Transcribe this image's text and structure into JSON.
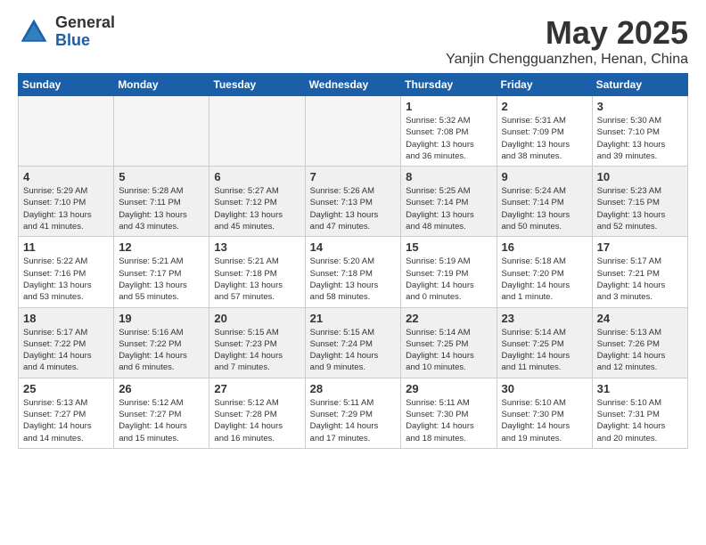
{
  "logo": {
    "general": "General",
    "blue": "Blue"
  },
  "title": {
    "month": "May 2025",
    "location": "Yanjin Chengguanzhen, Henan, China"
  },
  "weekdays": [
    "Sunday",
    "Monday",
    "Tuesday",
    "Wednesday",
    "Thursday",
    "Friday",
    "Saturday"
  ],
  "weeks": [
    [
      {
        "day": "",
        "info": ""
      },
      {
        "day": "",
        "info": ""
      },
      {
        "day": "",
        "info": ""
      },
      {
        "day": "",
        "info": ""
      },
      {
        "day": "1",
        "info": "Sunrise: 5:32 AM\nSunset: 7:08 PM\nDaylight: 13 hours\nand 36 minutes."
      },
      {
        "day": "2",
        "info": "Sunrise: 5:31 AM\nSunset: 7:09 PM\nDaylight: 13 hours\nand 38 minutes."
      },
      {
        "day": "3",
        "info": "Sunrise: 5:30 AM\nSunset: 7:10 PM\nDaylight: 13 hours\nand 39 minutes."
      }
    ],
    [
      {
        "day": "4",
        "info": "Sunrise: 5:29 AM\nSunset: 7:10 PM\nDaylight: 13 hours\nand 41 minutes."
      },
      {
        "day": "5",
        "info": "Sunrise: 5:28 AM\nSunset: 7:11 PM\nDaylight: 13 hours\nand 43 minutes."
      },
      {
        "day": "6",
        "info": "Sunrise: 5:27 AM\nSunset: 7:12 PM\nDaylight: 13 hours\nand 45 minutes."
      },
      {
        "day": "7",
        "info": "Sunrise: 5:26 AM\nSunset: 7:13 PM\nDaylight: 13 hours\nand 47 minutes."
      },
      {
        "day": "8",
        "info": "Sunrise: 5:25 AM\nSunset: 7:14 PM\nDaylight: 13 hours\nand 48 minutes."
      },
      {
        "day": "9",
        "info": "Sunrise: 5:24 AM\nSunset: 7:14 PM\nDaylight: 13 hours\nand 50 minutes."
      },
      {
        "day": "10",
        "info": "Sunrise: 5:23 AM\nSunset: 7:15 PM\nDaylight: 13 hours\nand 52 minutes."
      }
    ],
    [
      {
        "day": "11",
        "info": "Sunrise: 5:22 AM\nSunset: 7:16 PM\nDaylight: 13 hours\nand 53 minutes."
      },
      {
        "day": "12",
        "info": "Sunrise: 5:21 AM\nSunset: 7:17 PM\nDaylight: 13 hours\nand 55 minutes."
      },
      {
        "day": "13",
        "info": "Sunrise: 5:21 AM\nSunset: 7:18 PM\nDaylight: 13 hours\nand 57 minutes."
      },
      {
        "day": "14",
        "info": "Sunrise: 5:20 AM\nSunset: 7:18 PM\nDaylight: 13 hours\nand 58 minutes."
      },
      {
        "day": "15",
        "info": "Sunrise: 5:19 AM\nSunset: 7:19 PM\nDaylight: 14 hours\nand 0 minutes."
      },
      {
        "day": "16",
        "info": "Sunrise: 5:18 AM\nSunset: 7:20 PM\nDaylight: 14 hours\nand 1 minute."
      },
      {
        "day": "17",
        "info": "Sunrise: 5:17 AM\nSunset: 7:21 PM\nDaylight: 14 hours\nand 3 minutes."
      }
    ],
    [
      {
        "day": "18",
        "info": "Sunrise: 5:17 AM\nSunset: 7:22 PM\nDaylight: 14 hours\nand 4 minutes."
      },
      {
        "day": "19",
        "info": "Sunrise: 5:16 AM\nSunset: 7:22 PM\nDaylight: 14 hours\nand 6 minutes."
      },
      {
        "day": "20",
        "info": "Sunrise: 5:15 AM\nSunset: 7:23 PM\nDaylight: 14 hours\nand 7 minutes."
      },
      {
        "day": "21",
        "info": "Sunrise: 5:15 AM\nSunset: 7:24 PM\nDaylight: 14 hours\nand 9 minutes."
      },
      {
        "day": "22",
        "info": "Sunrise: 5:14 AM\nSunset: 7:25 PM\nDaylight: 14 hours\nand 10 minutes."
      },
      {
        "day": "23",
        "info": "Sunrise: 5:14 AM\nSunset: 7:25 PM\nDaylight: 14 hours\nand 11 minutes."
      },
      {
        "day": "24",
        "info": "Sunrise: 5:13 AM\nSunset: 7:26 PM\nDaylight: 14 hours\nand 12 minutes."
      }
    ],
    [
      {
        "day": "25",
        "info": "Sunrise: 5:13 AM\nSunset: 7:27 PM\nDaylight: 14 hours\nand 14 minutes."
      },
      {
        "day": "26",
        "info": "Sunrise: 5:12 AM\nSunset: 7:27 PM\nDaylight: 14 hours\nand 15 minutes."
      },
      {
        "day": "27",
        "info": "Sunrise: 5:12 AM\nSunset: 7:28 PM\nDaylight: 14 hours\nand 16 minutes."
      },
      {
        "day": "28",
        "info": "Sunrise: 5:11 AM\nSunset: 7:29 PM\nDaylight: 14 hours\nand 17 minutes."
      },
      {
        "day": "29",
        "info": "Sunrise: 5:11 AM\nSunset: 7:30 PM\nDaylight: 14 hours\nand 18 minutes."
      },
      {
        "day": "30",
        "info": "Sunrise: 5:10 AM\nSunset: 7:30 PM\nDaylight: 14 hours\nand 19 minutes."
      },
      {
        "day": "31",
        "info": "Sunrise: 5:10 AM\nSunset: 7:31 PM\nDaylight: 14 hours\nand 20 minutes."
      }
    ]
  ]
}
